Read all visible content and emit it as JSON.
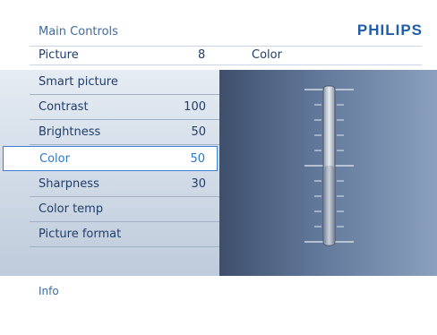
{
  "header": {
    "title": "Main Controls",
    "logo": "PHILIPS"
  },
  "breadcrumb": {
    "section": "Picture",
    "section_value": "8",
    "submenu": "Color"
  },
  "menu": {
    "items": [
      {
        "label": "Smart picture",
        "value": ""
      },
      {
        "label": "Contrast",
        "value": "100"
      },
      {
        "label": "Brightness",
        "value": "50"
      },
      {
        "label": "Color",
        "value": "50",
        "selected": true
      },
      {
        "label": "Sharpness",
        "value": "30"
      },
      {
        "label": "Color temp",
        "value": ""
      },
      {
        "label": "Picture format",
        "value": ""
      }
    ]
  },
  "slider": {
    "label": "Color",
    "value": 50,
    "min": 0,
    "max": 100
  },
  "footer": {
    "info_label": "Info"
  },
  "colors": {
    "accent": "#2d77c7",
    "logo": "#1f5ea8"
  }
}
